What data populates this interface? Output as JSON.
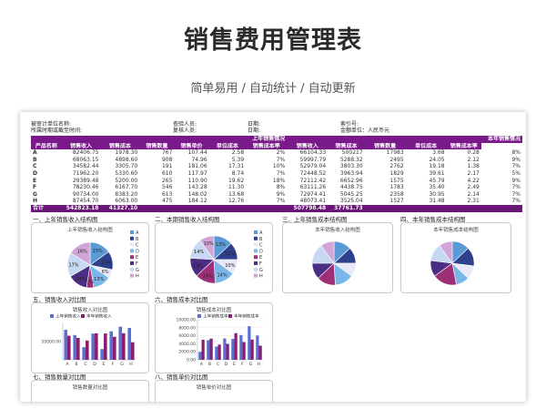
{
  "page": {
    "title": "销售费用管理表",
    "subtitle": "简单易用 / 自动统计 / 自动更新"
  },
  "sheet": {
    "meta": {
      "auditee": "被审计单位名称:",
      "period": "所属时期或截至时间:",
      "auditor": "查验人员:",
      "reviewer": "复核人员:",
      "date1": "日期:",
      "date2": "日期:",
      "index": "索引号:",
      "unit": "金额单位：人民币元"
    },
    "table": {
      "group_last": "上年销售情况",
      "group_this": "本年销售情况",
      "headers": [
        "产品名称",
        "销售收入",
        "销售成本",
        "销售数量",
        "销售单价",
        "单位成本",
        "销售成本率",
        "销售收入",
        "销售成本",
        "销售数量",
        "单位成本",
        "销售成本率"
      ],
      "rows": [
        [
          "A",
          "82406.75",
          "1978.30",
          "767",
          "107.44",
          "2.58",
          "2%",
          "66104.33",
          "500217",
          "17983",
          "3.68",
          "0.28",
          "8%"
        ],
        [
          "B",
          "68063.15",
          "4898.60",
          "908",
          "74.96",
          "5.39",
          "7%",
          "59997.79",
          "5288.32",
          "2495",
          "24.05",
          "2.12",
          "9%"
        ],
        [
          "C",
          "34582.44",
          "3305.70",
          "191",
          "181.06",
          "17.31",
          "10%",
          "52979.04",
          "3803.30",
          "2762",
          "19.18",
          "1.38",
          "7%"
        ],
        [
          "D",
          "71962.20",
          "5330.60",
          "610",
          "117.97",
          "8.74",
          "7%",
          "72448.52",
          "3963.94",
          "1829",
          "39.61",
          "2.17",
          "5%"
        ],
        [
          "E",
          "29389.48",
          "5200.00",
          "265",
          "110.90",
          "19.62",
          "18%",
          "72112.42",
          "6652.96",
          "1575",
          "45.79",
          "4.22",
          "9%"
        ],
        [
          "F",
          "78230.46",
          "6167.70",
          "546",
          "143.28",
          "11.30",
          "8%",
          "63111.26",
          "4438.75",
          "1783",
          "35.40",
          "2.49",
          "7%"
        ],
        [
          "G",
          "90734.00",
          "8383.20",
          "613",
          "148.02",
          "13.68",
          "9%",
          "72974.41",
          "5045.25",
          "2358",
          "30.95",
          "2.14",
          "7%"
        ],
        [
          "H",
          "87454.70",
          "6063.00",
          "475",
          "184.12",
          "12.76",
          "7%",
          "48073.41",
          "3525.04",
          "1527",
          "31.48",
          "2.31",
          "7%"
        ]
      ],
      "total": [
        "合计",
        "542823.18",
        "41327.10",
        "",
        "",
        "",
        "",
        "507798.48",
        "37761.73",
        "",
        "",
        "",
        ""
      ]
    },
    "sections": {
      "s1": "一、上年销售收入结构图",
      "s2": "二、本期销售收入结构图",
      "s3": "三、上年销售成本结构图",
      "s4": "四、本年销售成本结构图",
      "s5": "五、销售收入对比图",
      "s6": "六、销售成本对比图",
      "s7": "七、销售数量对比图",
      "s8": "八、销售单价对比图"
    }
  },
  "chart_data": [
    {
      "type": "pie",
      "title": "上年销售收入结构图",
      "categories": [
        "A",
        "B",
        "C",
        "D",
        "E",
        "F",
        "G",
        "H"
      ],
      "values": [
        15,
        13,
        6,
        13,
        5,
        14,
        17,
        16
      ],
      "labels": [
        "15%",
        "13%",
        "6%",
        "13%",
        "5%",
        "14%",
        "17%",
        "16%"
      ]
    },
    {
      "type": "pie",
      "title": "",
      "categories": [
        "A",
        "B",
        "C",
        "D",
        "E",
        "F",
        "G",
        "H"
      ],
      "values": [
        13,
        12,
        10,
        14,
        14,
        13,
        14,
        10
      ],
      "labels": [
        "13%",
        "12%",
        "10%",
        "14%",
        "14%",
        "13%",
        "14%",
        "10%"
      ]
    },
    {
      "type": "pie",
      "title": "本年销售收入结构图",
      "categories": [
        "A",
        "B",
        "C",
        "D",
        "E",
        "F",
        "G",
        "H"
      ],
      "values": [
        13,
        12,
        10,
        14,
        14,
        12,
        15,
        10
      ]
    },
    {
      "type": "pie",
      "title": "本年销售成本结构图",
      "categories": [
        "A",
        "B",
        "C",
        "D",
        "E",
        "F",
        "G",
        "H"
      ],
      "values": [
        13,
        14,
        10,
        10,
        18,
        12,
        13,
        10
      ]
    },
    {
      "type": "bar",
      "title": "销售收入对比图",
      "categories": [
        "A",
        "B",
        "C",
        "D",
        "E",
        "F",
        "G",
        "H"
      ],
      "series": [
        {
          "name": "上年销售收入",
          "values": [
            82406.75,
            68063.15,
            34582.44,
            71962.2,
            29389.48,
            78230.46,
            90734.0,
            87454.7
          ]
        },
        {
          "name": "本年销售收入",
          "values": [
            66104.33,
            59997.79,
            52979.04,
            72448.52,
            72112.42,
            63111.26,
            72974.41,
            48073.41
          ]
        }
      ],
      "ytick": "50000.00",
      "ylim": [
        0,
        100000
      ]
    },
    {
      "type": "bar",
      "title": "销售成本对比图",
      "categories": [
        "A",
        "B",
        "C",
        "D",
        "E",
        "F",
        "G",
        "H"
      ],
      "series": [
        {
          "name": "上年销售成本",
          "values": [
            1978.3,
            4898.6,
            3305.7,
            5330.6,
            5200.0,
            6167.7,
            8383.2,
            6063.0
          ]
        },
        {
          "name": "本年销售成本",
          "values": [
            5002.17,
            5288.32,
            3803.3,
            3963.94,
            6652.96,
            4438.75,
            5045.25,
            3525.04
          ]
        }
      ],
      "yticks": [
        "10000.00",
        "8000.00",
        "6000.00",
        "4000.00",
        "2000.00",
        "0.00"
      ],
      "ylim": [
        0,
        10000
      ]
    },
    {
      "type": "bar",
      "title": "销售数量对比图"
    },
    {
      "type": "bar",
      "title": "销售单价对比图"
    }
  ],
  "colors": {
    "header": "#7a1a8a",
    "total": "#6a1678",
    "s1": "#5b6fd1",
    "s2": "#8a1f6e",
    "pie": [
      "#5b9bd5",
      "#2e3f8c",
      "#e8e8f8",
      "#7ab7e8",
      "#9c2f76",
      "#4b2d84",
      "#c7d9f2",
      "#d1a5d8"
    ]
  }
}
